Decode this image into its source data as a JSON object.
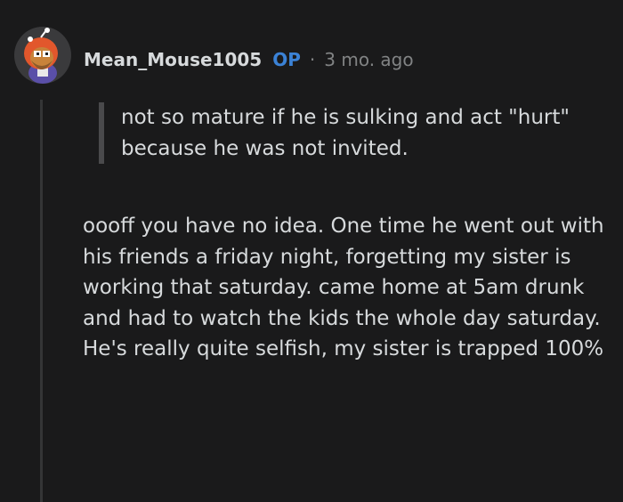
{
  "comment": {
    "username": "Mean_Mouse1005",
    "badge": "OP",
    "separator": "·",
    "timestamp": "3 mo. ago",
    "avatar_icon": "snoo-avatar-icon",
    "quote": "not so mature if he is sulking and act \"hurt\" because he was not invited.",
    "body": "oooff you have no idea. One time he went out with his friends a friday night, forgetting my sister is working that saturday. came home at 5am drunk and had to watch the kids the whole day saturday. He's really quite selfish, my sister is trapped 100%"
  },
  "colors": {
    "background": "#1a1a1b",
    "text": "#d7dadc",
    "op_badge": "#3b82d6",
    "muted": "#818384"
  }
}
